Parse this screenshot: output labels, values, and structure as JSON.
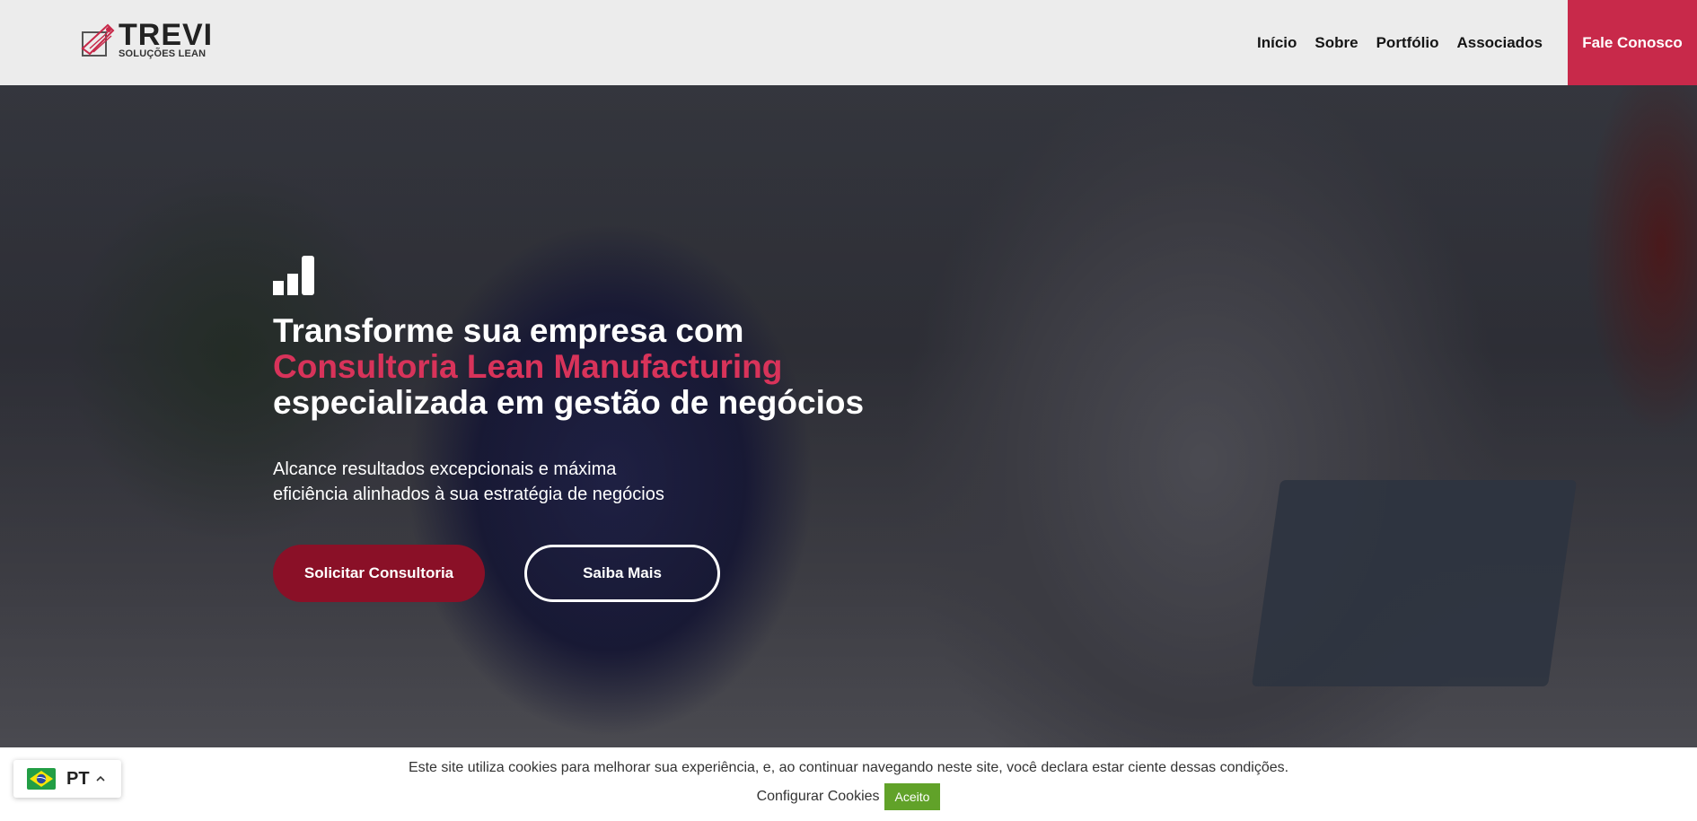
{
  "header": {
    "logo": {
      "title": "TREVI",
      "subtitle": "SOLUÇÕES LEAN"
    },
    "nav": [
      {
        "label": "Início"
      },
      {
        "label": "Sobre"
      },
      {
        "label": "Portfólio"
      },
      {
        "label": "Associados"
      }
    ],
    "cta_label": "Fale Conosco"
  },
  "hero": {
    "icon": "bar-chart-icon",
    "headline": {
      "line1": "Transforme sua empresa com",
      "line2_accent": "Consultoria Lean Manufacturing",
      "line3": "especializada em gestão de negócios"
    },
    "subheadline": "Alcance resultados excepcionais e máxima eficiência alinhados à sua estratégia de negócios",
    "primary_button": "Solicitar Consultoria",
    "secondary_button": "Saiba Mais"
  },
  "cookie_bar": {
    "message": "Este site utiliza cookies para melhorar sua experiência, e, ao continuar navegando neste site, você declara estar ciente dessas condições.",
    "settings_link": "Configurar Cookies",
    "accept_button": "Aceito"
  },
  "language_switcher": {
    "flag": "brazil-flag-icon",
    "code": "PT",
    "chevron": "chevron-up-icon"
  },
  "colors": {
    "accent": "#d8335a",
    "cta_background": "#c8294a",
    "primary_button": "#8a1027",
    "accept_button": "#61a229",
    "header_background": "#ececec"
  }
}
